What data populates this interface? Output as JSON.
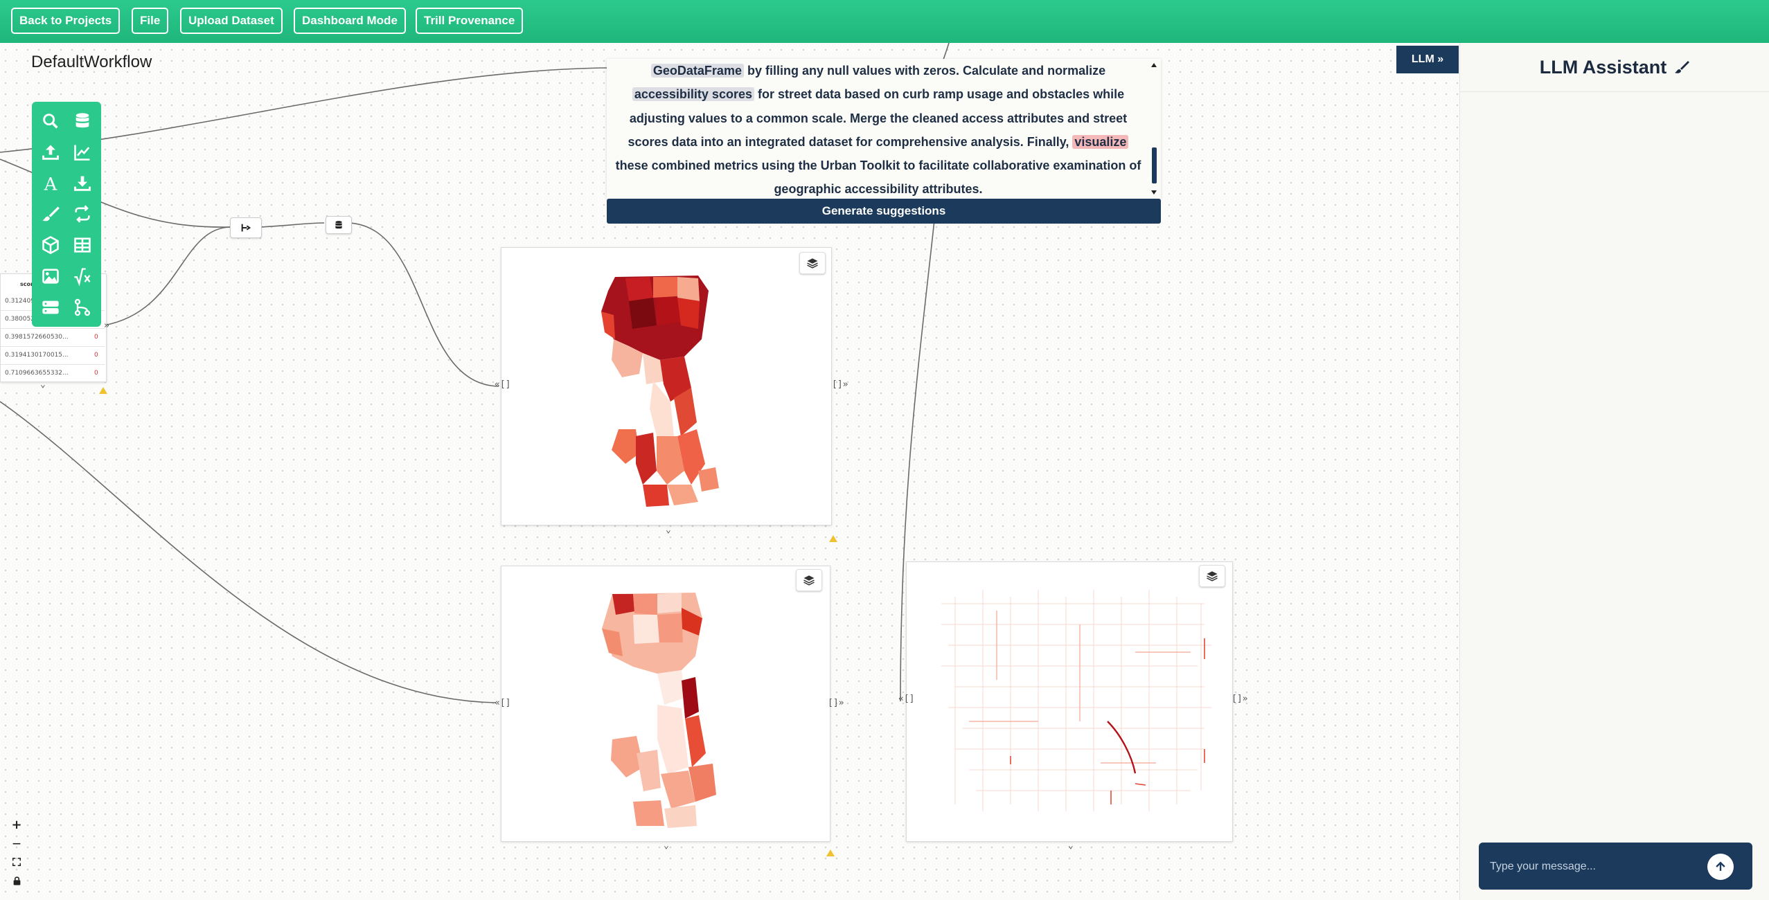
{
  "topbar": {
    "back_label": "Back to Projects",
    "file_label": "File",
    "upload_label": "Upload Dataset",
    "dashboard_label": "Dashboard Mode",
    "provenance_label": "Trill Provenance"
  },
  "workflow": {
    "title": "DefaultWorkflow"
  },
  "toolbox": {
    "icons": [
      "search-data-icon",
      "database-icon",
      "upload-icon",
      "line-chart-icon",
      "text-icon",
      "download-icon",
      "brush-icon",
      "loop-icon",
      "cube-icon",
      "table-icon",
      "image-icon",
      "formula-icon",
      "server-icon",
      "branch-icon"
    ]
  },
  "table_node": {
    "header": "score",
    "rows": [
      {
        "value": "0.3124095...",
        "flag": "0"
      },
      {
        "value": "0.3800521...",
        "flag": "0"
      },
      {
        "value": "0.3981572660530...",
        "flag": "0"
      },
      {
        "value": "0.3194130170015...",
        "flag": "0"
      },
      {
        "value": "0.7109663655332...",
        "flag": "0"
      }
    ]
  },
  "prompt": {
    "part1": "GeoDataFrame",
    "part2": " by filling any null values with zeros. Calculate and normalize ",
    "part3": "accessibility scores",
    "part4": " for street data based on curb ramp usage and obstacles while adjusting values to a common scale. Merge the cleaned access attributes and street scores data into an integrated dataset for comprehensive analysis. Finally, ",
    "part5": "visualize",
    "part6": " these combined metrics using the Urban Toolkit to facilitate collaborative examination of geographic accessibility attributes.",
    "generate_label": "Generate suggestions"
  },
  "llm": {
    "toggle_label": "LLM »",
    "title": "LLM Assistant",
    "input_placeholder": "Type your message..."
  },
  "zoom": {
    "plus": "+",
    "minus": "—"
  },
  "colors": {
    "accent_green": "#2cc98d",
    "navy": "#1b3a5c",
    "map_dark": "#9e0b14",
    "map_light": "#fde3d8"
  }
}
